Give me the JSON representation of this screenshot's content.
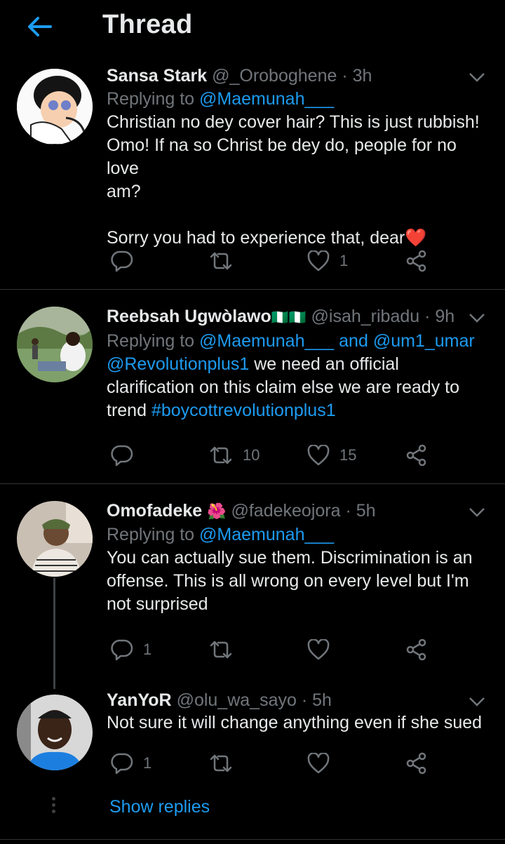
{
  "header": {
    "title": "Thread"
  },
  "tweets": [
    {
      "name": "Sansa Stark",
      "handle": "@_Oroboghene",
      "dot": "·",
      "time": "3h",
      "replying_prefix": "Replying to",
      "replying_to": "@Maemunah___",
      "text": "Christian no dey cover hair? This is just rubbish!\nOmo! If na so Christ be dey do, people for no love\nam?\n\nSorry you had to experience that, dear",
      "emoji": "❤️",
      "replies": "",
      "retweets": "",
      "likes": "1"
    },
    {
      "name": "Reebsah Ugwòlawo",
      "flags": "🇳🇬🇳🇬",
      "handle": "@isah_ribadu",
      "dot": "·",
      "time": "9h",
      "replying_prefix": "Replying to",
      "replying_to": "@Maemunah___",
      "and": "and",
      "replying_to_2": "@um1_umar",
      "text_mention": "@Revolutionplus1",
      "text_1": " we need an official\nclarification on this claim else we are ready to\ntrend ",
      "text_hashtag": "#boycottrevolutionplus1",
      "replies": "",
      "retweets": "10",
      "likes": "15"
    },
    {
      "name": "Omofadeke",
      "emoji": "🌺",
      "handle": "@fadekeojora",
      "dot": "·",
      "time": "5h",
      "replying_prefix": "Replying to",
      "replying_to": "@Maemunah___",
      "text": "You can actually sue them. Discrimination is an\noffense. This is all wrong on every level but I'm\nnot surprised",
      "replies": "1",
      "retweets": "",
      "likes": ""
    },
    {
      "name": "YanYoR",
      "handle": "@olu_wa_sayo",
      "dot": "·",
      "time": "5h",
      "text": "Not sure it will change anything even if she sued",
      "replies": "1",
      "retweets": "",
      "likes": ""
    }
  ],
  "show_replies": "Show replies",
  "colors": {
    "accent": "#1d9bf0",
    "muted": "#71767b",
    "background": "#000000"
  }
}
